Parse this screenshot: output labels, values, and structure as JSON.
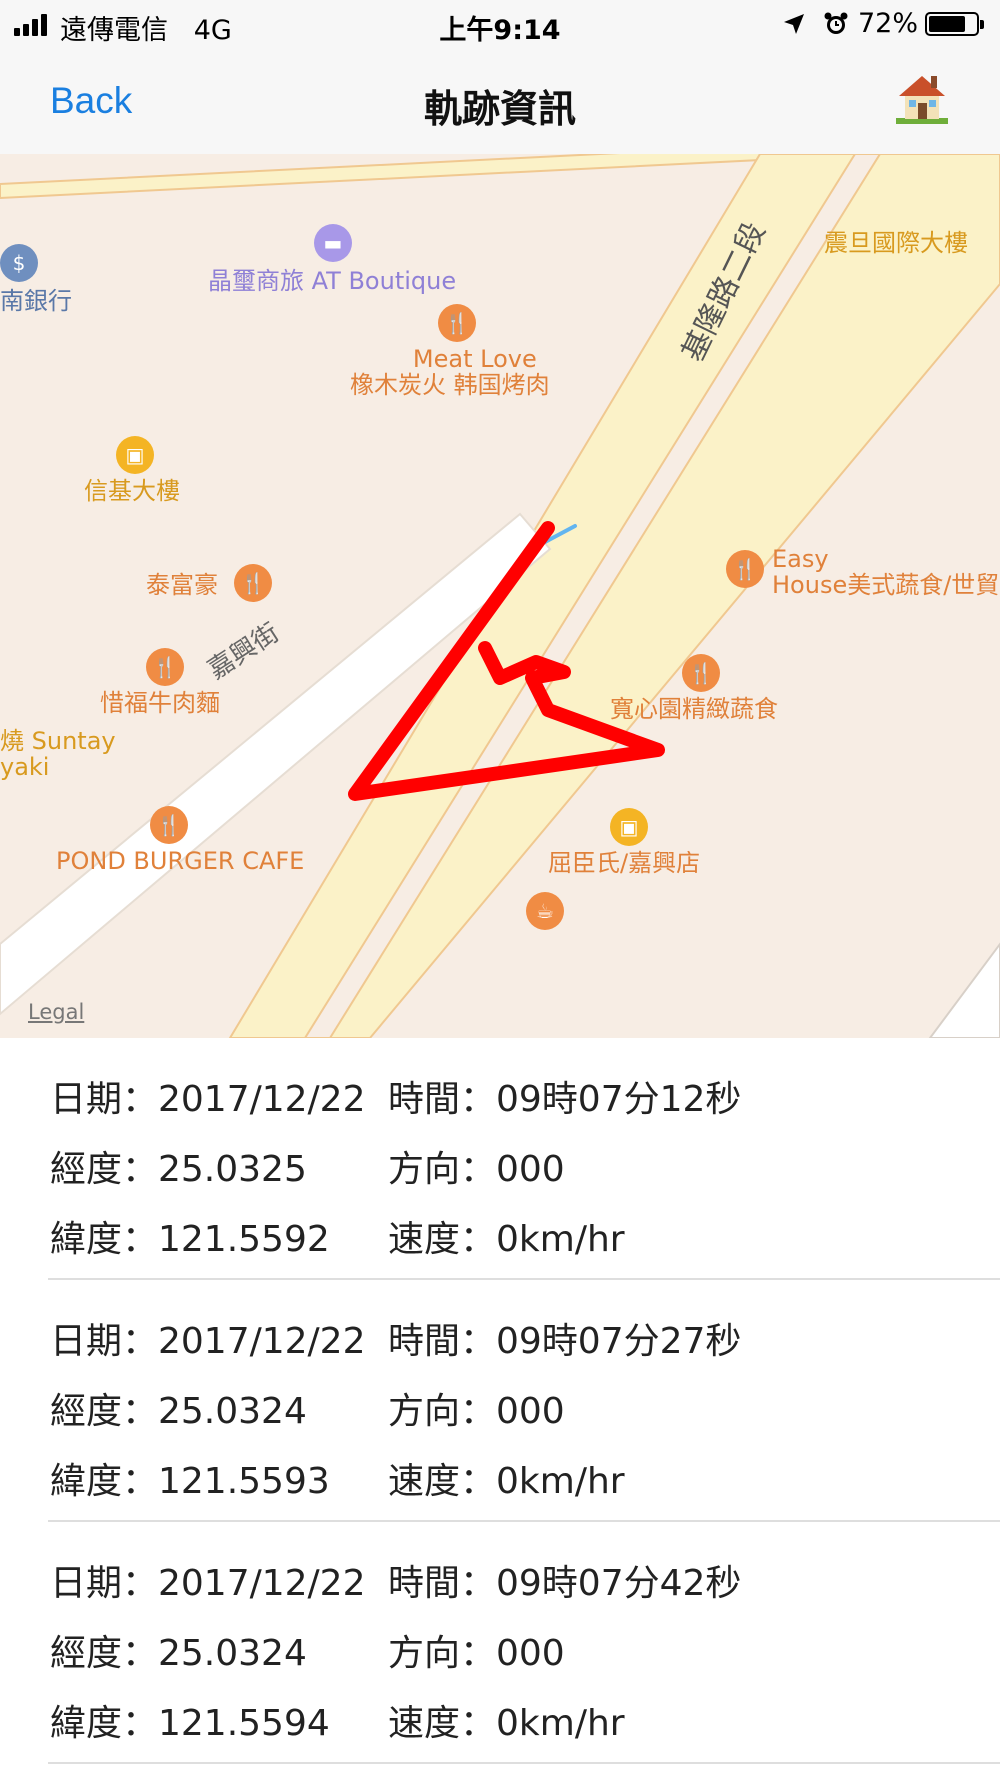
{
  "status_bar": {
    "carrier": "遠傳電信",
    "network": "4G",
    "time": "上午9:14",
    "battery": "72%",
    "battery_level": 0.72
  },
  "nav": {
    "back_label": "Back",
    "title": "軌跡資訊",
    "home_icon": "house-emoji-icon"
  },
  "map": {
    "legal": "Legal",
    "labels": {
      "hotel": "晶璽商旅 AT Boutique",
      "bank": "南銀行",
      "tower": "震旦國際大樓",
      "road_main": "基隆路二段",
      "meat_love_1": "Meat Love",
      "meat_love_2": "橡木炭火 韩国烤肉",
      "xinji": "信基大樓",
      "taifuhao": "泰富豪",
      "street_jiaxing": "嘉興街",
      "xifu": "惜福牛肉麵",
      "easy_house_1": "Easy",
      "easy_house_2": "House美式蔬食/世貿",
      "kuanxin": "寬心園精緻蔬食",
      "suntay_1": "燒 Suntay",
      "suntay_2": "yaki",
      "pond": "POND BURGER CAFE",
      "watsons": "屈臣氏/嘉興店"
    },
    "track_color": "#ff0000"
  },
  "records": [
    {
      "date_label": "日期：2017/12/22",
      "time_label": "時間：09時07分12秒",
      "lng_label": "經度：25.0325",
      "dir_label": "方向：000",
      "lat_label": "緯度：121.5592",
      "speed_label": "速度：0km/hr"
    },
    {
      "date_label": "日期：2017/12/22",
      "time_label": "時間：09時07分27秒",
      "lng_label": "經度：25.0324",
      "dir_label": "方向：000",
      "lat_label": "緯度：121.5593",
      "speed_label": "速度：0km/hr"
    },
    {
      "date_label": "日期：2017/12/22",
      "time_label": "時間：09時07分42秒",
      "lng_label": "經度：25.0324",
      "dir_label": "方向：000",
      "lat_label": "緯度：121.5594",
      "speed_label": "速度：0km/hr"
    }
  ]
}
